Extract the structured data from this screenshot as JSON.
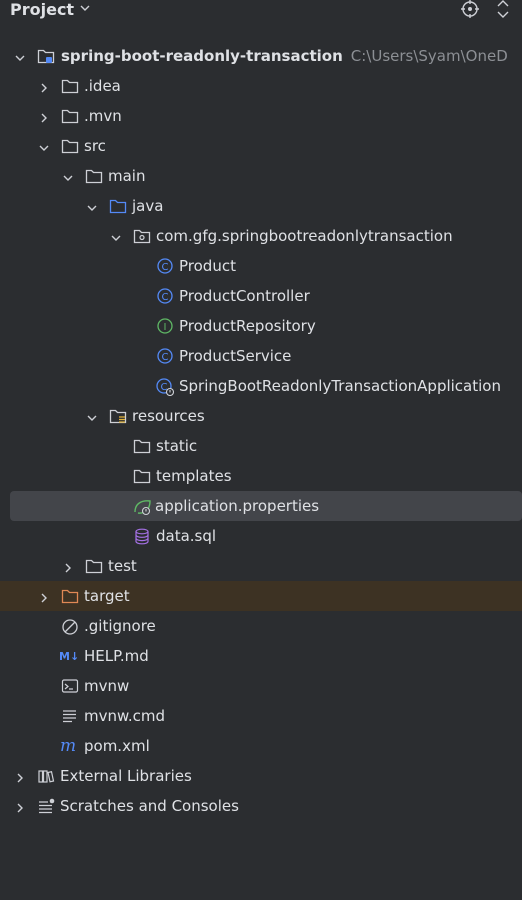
{
  "header": {
    "title": "Project"
  },
  "tree": {
    "root": {
      "label": "spring-boot-readonly-transaction",
      "path": "C:\\Users\\Syam\\OneD"
    },
    "idea": ".idea",
    "mvn": ".mvn",
    "src": "src",
    "main": "main",
    "java": "java",
    "package": "com.gfg.springbootreadonlytransaction",
    "product": "Product",
    "product_controller": "ProductController",
    "product_repository": "ProductRepository",
    "product_service": "ProductService",
    "app_class": "SpringBootReadonlyTransactionApplication",
    "resources": "resources",
    "static": "static",
    "templates": "templates",
    "app_props": "application.properties",
    "data_sql": "data.sql",
    "test": "test",
    "target": "target",
    "gitignore": ".gitignore",
    "help_md": "HELP.md",
    "mvnw": "mvnw",
    "mvnw_cmd": "mvnw.cmd",
    "pom": "pom.xml",
    "external_libraries": "External Libraries",
    "scratches": "Scratches and Consoles"
  },
  "colors": {
    "background": "#2b2d30",
    "selection": "#43454a",
    "excluded_row": "#3d3223",
    "class_icon": "#548af7",
    "interface_icon": "#5fb865",
    "spring_icon": "#5fb865",
    "excluded_folder": "#e08855",
    "db_icon": "#a571e6"
  }
}
